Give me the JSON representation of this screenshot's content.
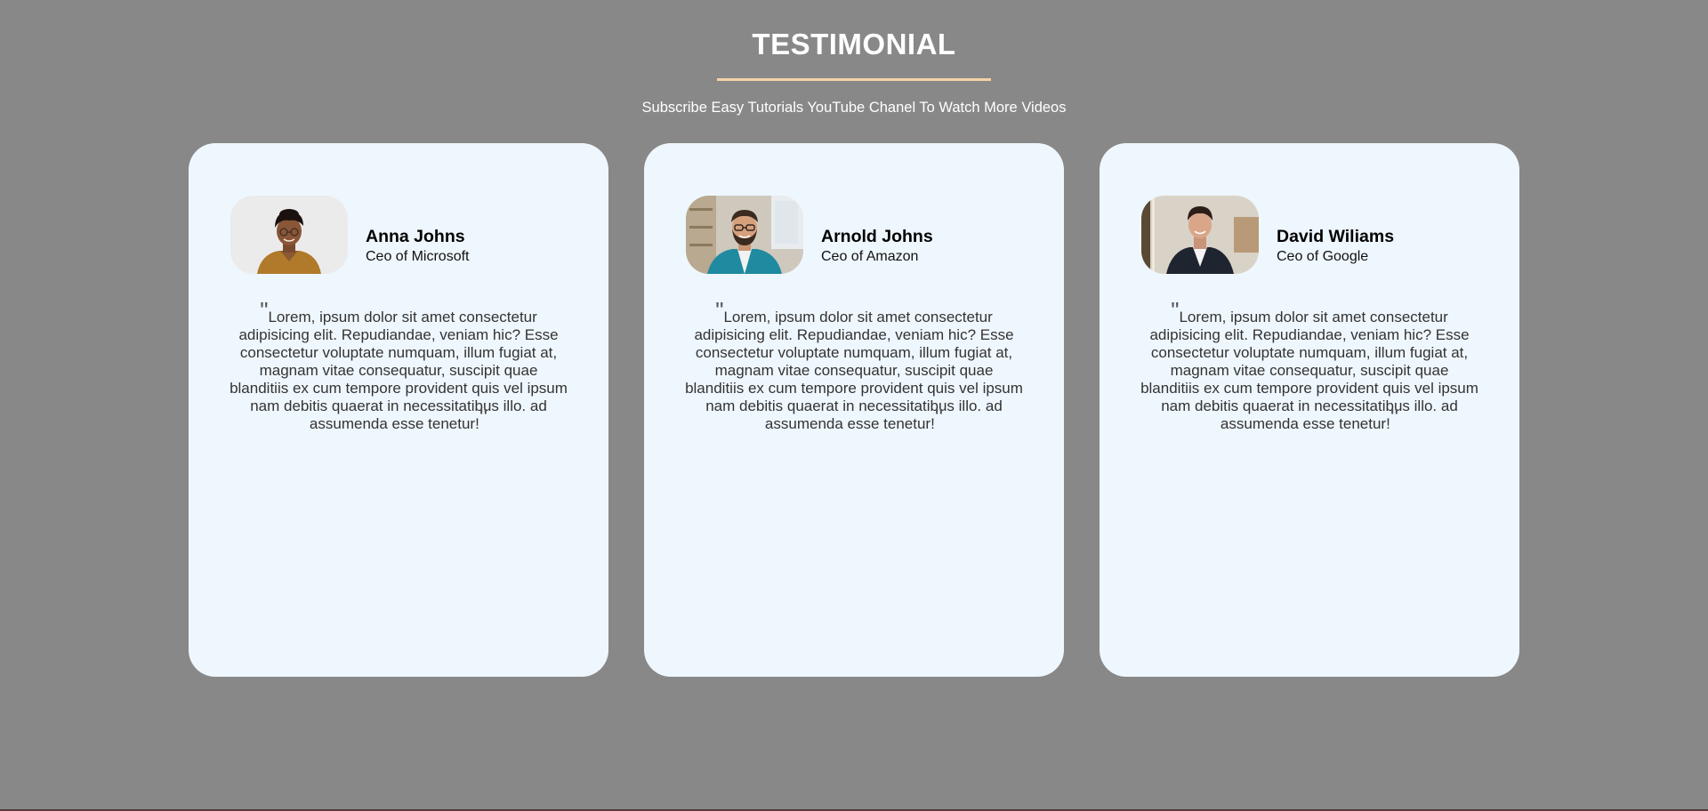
{
  "header": {
    "title": "TESTIMONIAL",
    "subtitle": "Subscribe Easy Tutorials YouTube Chanel To Watch More Videos"
  },
  "colors": {
    "page_background": "#888888",
    "card_background": "#eff7fe",
    "underline_accent": "#f3d2a8"
  },
  "quote_marks": {
    "open": "\"",
    "close": "\""
  },
  "testimonials": [
    {
      "name": "Anna Johns",
      "role": "Ceo of Microsoft",
      "quote": "Lorem, ipsum dolor sit amet consectetur adipisicing elit. Repudiandae, veniam hic? Esse consectetur voluptate numquam, illum fugiat at, magnam vitae consequatur, suscipit quae blanditiis ex cum tempore provident quis vel ipsum nam debitis quaerat in necessitatibus illo. ad assumenda esse tenetur!"
    },
    {
      "name": "Arnold Johns",
      "role": "Ceo of Amazon",
      "quote": "Lorem, ipsum dolor sit amet consectetur adipisicing elit. Repudiandae, veniam hic? Esse consectetur voluptate numquam, illum fugiat at, magnam vitae consequatur, suscipit quae blanditiis ex cum tempore provident quis vel ipsum nam debitis quaerat in necessitatibus illo. ad assumenda esse tenetur!"
    },
    {
      "name": "David Wiliams",
      "role": "Ceo of Google",
      "quote": "Lorem, ipsum dolor sit amet consectetur adipisicing elit. Repudiandae, veniam hic? Esse consectetur voluptate numquam, illum fugiat at, magnam vitae consequatur, suscipit quae blanditiis ex cum tempore provident quis vel ipsum nam debitis quaerat in necessitatibus illo. ad assumenda esse tenetur!"
    }
  ]
}
